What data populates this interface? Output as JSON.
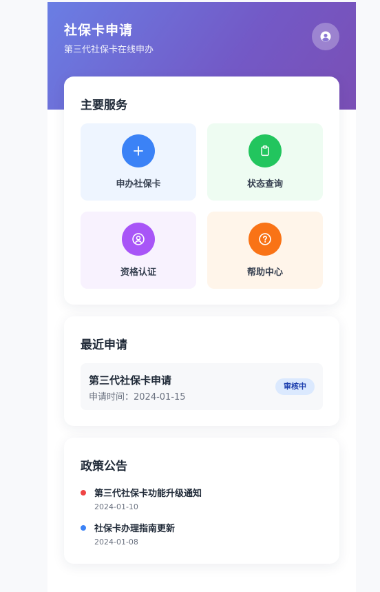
{
  "header": {
    "title": "社保卡申请",
    "subtitle": "第三代社保卡在线申办",
    "avatar_icon": "user-circle-icon",
    "gradient_colors": [
      "#6a7ee4",
      "#7a4fb5"
    ]
  },
  "services": {
    "title": "主要服务",
    "items": [
      {
        "label": "申办社保卡",
        "icon": "plus-icon",
        "icon_color": "#3b82f6",
        "tile_color": "#eef5ff"
      },
      {
        "label": "状态查询",
        "icon": "clipboard-icon",
        "icon_color": "#22c55e",
        "tile_color": "#eefcf2"
      },
      {
        "label": "资格认证",
        "icon": "user-circle-icon",
        "icon_color": "#a855f7",
        "tile_color": "#f8f2fe"
      },
      {
        "label": "帮助中心",
        "icon": "help-circle-icon",
        "icon_color": "#f97316",
        "tile_color": "#fff5ea"
      }
    ]
  },
  "recent": {
    "title": "最近申请",
    "items": [
      {
        "title": "第三代社保卡申请",
        "time": "申请时间：2024-01-15",
        "status": "审核中"
      }
    ]
  },
  "policy": {
    "title": "政策公告",
    "items": [
      {
        "title": "第三代社保卡功能升级通知",
        "date": "2024-01-10",
        "dot_color": "#ef4444"
      },
      {
        "title": "社保卡办理指南更新",
        "date": "2024-01-08",
        "dot_color": "#3b82f6"
      }
    ]
  }
}
